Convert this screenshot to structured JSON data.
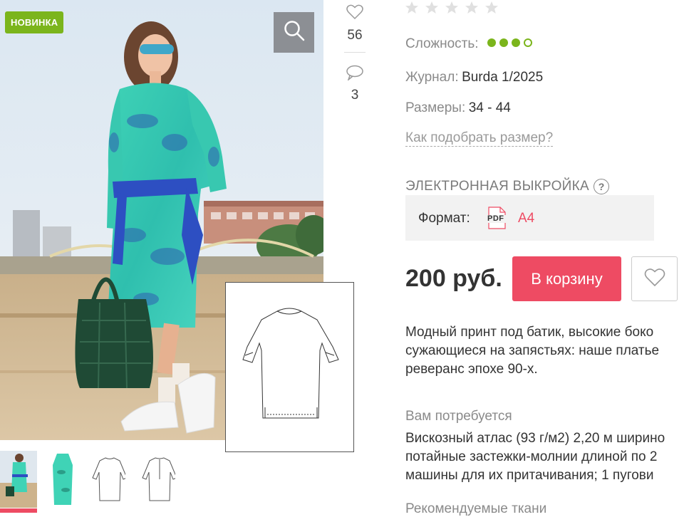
{
  "product": {
    "badge": "НОВИНКА",
    "likes": "56",
    "comments": "3"
  },
  "rating": {
    "stars": 5,
    "filled": 0
  },
  "complexity": {
    "label": "Сложность:",
    "level": 3,
    "max": 4
  },
  "journal": {
    "label": "Журнал:",
    "value": "Burda 1/2025"
  },
  "sizes": {
    "label": "Размеры:",
    "value": "34 - 44"
  },
  "size_link": "Как подобрать размер?",
  "section": {
    "title": "ЭЛЕКТРОННАЯ ВЫКРОЙКА",
    "help": "?",
    "format_label": "Формат:",
    "format_icon_text": "PDF",
    "format_value": "A4"
  },
  "purchase": {
    "price": "200 руб.",
    "cart_label": "В корзину"
  },
  "description": {
    "line1": "Модный принт под батик, высокие боко",
    "line2": "сужающиеся на запястьях: наше платье",
    "line3": "реверанс эпохе 90-х."
  },
  "needs": {
    "title": "Вам потребуется",
    "line1": "Вискозный атлас (93 г/м2) 2,20 м ширино",
    "line2": "потайные застежки-молнии длиной по 2",
    "line3": "машины для их притачивания; 1 пугови"
  },
  "fabrics_title": "Рекомендуемые ткани",
  "colors": {
    "accent": "#ee4b63",
    "green": "#7bb51c"
  }
}
